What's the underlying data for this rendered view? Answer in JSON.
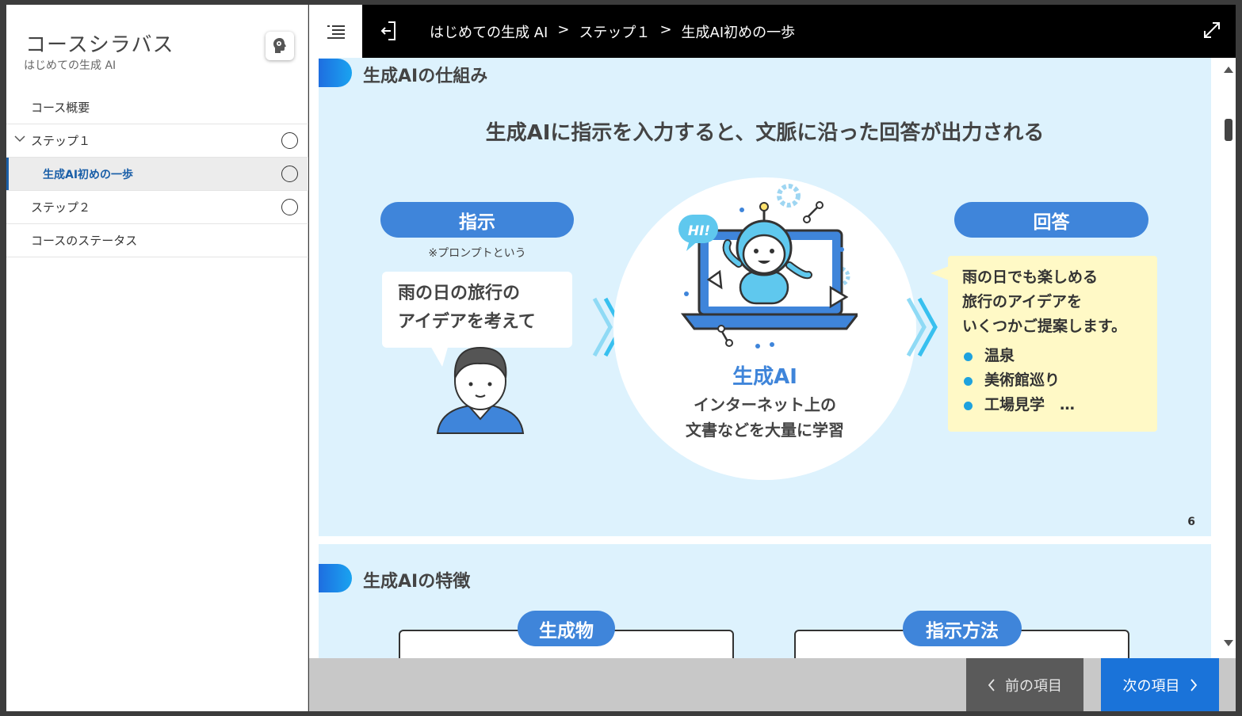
{
  "sidebar": {
    "title": "コースシラバス",
    "subtitle": "はじめての生成 AI",
    "items": [
      {
        "label": "コース概要"
      },
      {
        "label": "ステップ１"
      },
      {
        "label": "生成AI初めの一歩"
      },
      {
        "label": "ステップ２"
      },
      {
        "label": "コースのステータス"
      }
    ]
  },
  "header": {
    "breadcrumb": [
      "はじめての生成 AI",
      "ステップ１",
      "生成AI初めの一歩"
    ]
  },
  "slide1": {
    "heading": "生成AIの仕組み",
    "headline": "生成AIに指示を入力すると、文脈に沿った回答が出力される",
    "instruction_label": "指示",
    "instruction_note": "※プロンプトという",
    "prompt_line1": "雨の日の旅行の",
    "prompt_line2": "アイデアを考えて",
    "hi_text": "HI!",
    "ai_name": "生成AI",
    "ai_desc_line1": "インターネット上の",
    "ai_desc_line2": "文書などを大量に学習",
    "answer_label": "回答",
    "answer_line1": "雨の日でも楽しめる",
    "answer_line2": "旅行のアイデアを",
    "answer_line3": "いくつかご提案します。",
    "answer_items": [
      "温泉",
      "美術館巡り",
      "工場見学　…"
    ],
    "page_number": "6"
  },
  "slide2": {
    "heading": "生成AIの特徴",
    "pill_left": "生成物",
    "pill_right": "指示方法"
  },
  "footer": {
    "prev_label": "前の項目",
    "next_label": "次の項目"
  },
  "colors": {
    "accent_blue": "#3f85da",
    "slide_bg": "#ddf2fd",
    "answer_bg": "#fff9c6",
    "next_button": "#1a73d9"
  }
}
